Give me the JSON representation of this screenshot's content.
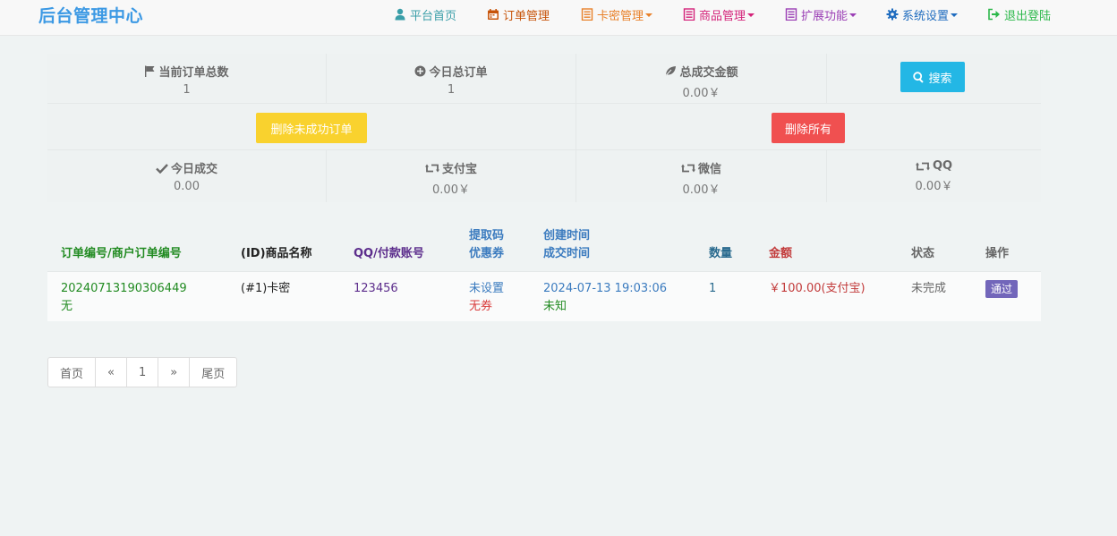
{
  "brand": "后台管理中心",
  "nav": {
    "home": "平台首页",
    "orders": "订单管理",
    "cards": "卡密管理",
    "goods": "商品管理",
    "ext": "扩展功能",
    "settings": "系统设置",
    "logout": "退出登陆"
  },
  "colors": {
    "brand": "#3c99e4",
    "nav_home": "#3a9ea8",
    "nav_orders": "#c7540a",
    "nav_cards": "#e8812a",
    "nav_goods": "#d4237a",
    "nav_ext": "#9b3fb5",
    "nav_settings": "#1f6cbf",
    "nav_logout": "#2db84b",
    "btn_search": "#23b7e5",
    "btn_delete_failed": "#f9d22e",
    "btn_delete_all": "#f05050",
    "badge_pass": "#7266ba"
  },
  "stats": {
    "current_orders": {
      "label": "当前订单总数",
      "value": "1"
    },
    "today_orders": {
      "label": "今日总订单",
      "value": "1"
    },
    "total_amount": {
      "label": "总成交金额",
      "value": "0.00￥"
    },
    "today_success": {
      "label": "今日成交",
      "value": "0.00"
    },
    "alipay": {
      "label": "支付宝",
      "value": "0.00￥"
    },
    "wechat": {
      "label": "微信",
      "value": "0.00￥"
    },
    "qq": {
      "label": "QQ",
      "value": "0.00￥"
    }
  },
  "buttons": {
    "search": "搜索",
    "delete_failed": "删除未成功订单",
    "delete_all": "删除所有"
  },
  "table": {
    "headers": {
      "order_no": "订单编号/商户订单编号",
      "goods": "(ID)商品名称",
      "account": "QQ/付款账号",
      "code1": "提取码",
      "code2": "优惠券",
      "time1": "创建时间",
      "time2": "成交时间",
      "qty": "数量",
      "amount": "金额",
      "status": "状态",
      "action": "操作"
    },
    "rows": [
      {
        "order_no": "20240713190306449",
        "merchant_no": "无",
        "goods": "(#1)卡密",
        "account": "123456",
        "code": "未设置",
        "coupon": "无券",
        "created": "2024-07-13 19:03:06",
        "finished": "未知",
        "qty": "1",
        "amount": "￥100.00(支付宝)",
        "status": "未完成",
        "action": "通过"
      }
    ]
  },
  "pagination": {
    "first": "首页",
    "prev": "«",
    "page": "1",
    "next": "»",
    "last": "尾页"
  }
}
